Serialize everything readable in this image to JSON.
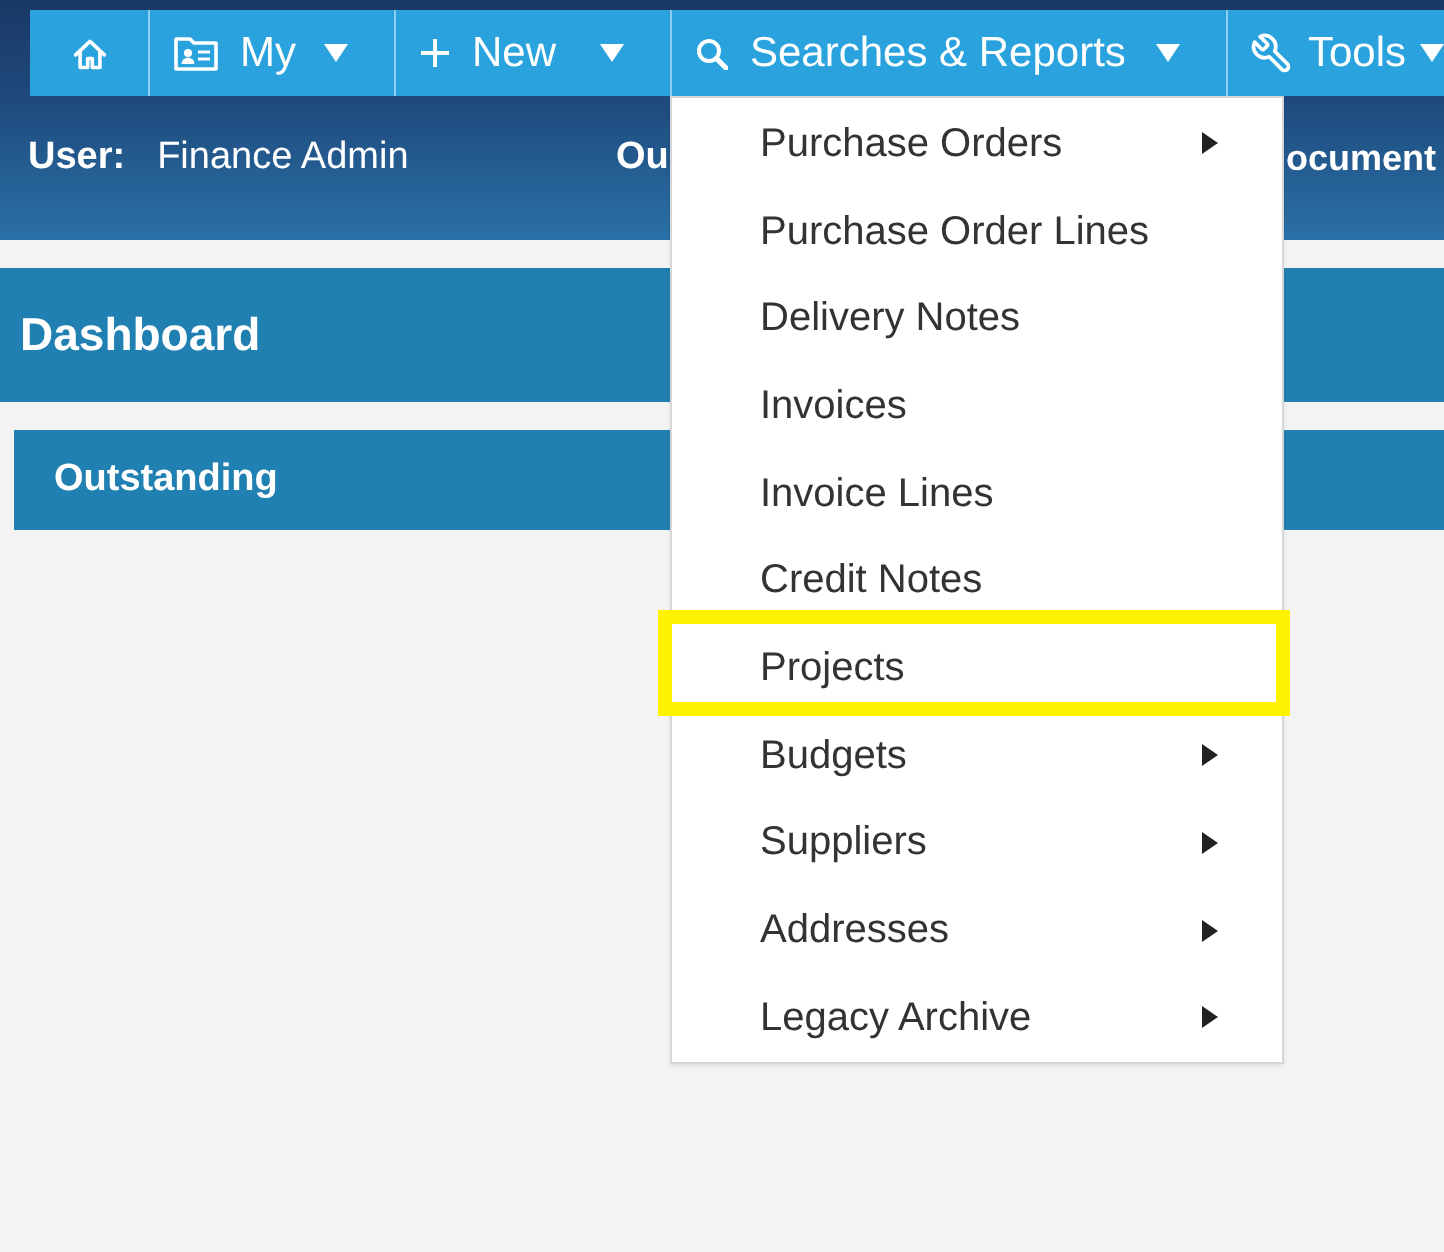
{
  "header": {
    "nav": [
      {
        "dropdown": false,
        "expanded": false
      },
      {
        "label": "My",
        "dropdown": true,
        "expanded": false
      },
      {
        "label": "New",
        "dropdown": true,
        "expanded": false
      },
      {
        "label": "Searches & Reports",
        "dropdown": true,
        "expanded": true,
        "menu": [
          {
            "label": "Purchase Orders",
            "submenu": true,
            "highlighted": false
          },
          {
            "label": "Purchase Order Lines",
            "submenu": false,
            "highlighted": false
          },
          {
            "label": "Delivery Notes",
            "submenu": false,
            "highlighted": false
          },
          {
            "label": "Invoices",
            "submenu": false,
            "highlighted": false
          },
          {
            "label": "Invoice Lines",
            "submenu": false,
            "highlighted": false
          },
          {
            "label": "Credit Notes",
            "submenu": false,
            "highlighted": false
          },
          {
            "label": "Projects",
            "submenu": false,
            "highlighted": true
          },
          {
            "label": "Budgets",
            "submenu": true,
            "highlighted": false
          },
          {
            "label": "Suppliers",
            "submenu": true,
            "highlighted": false
          },
          {
            "label": "Addresses",
            "submenu": true,
            "highlighted": false
          },
          {
            "label": "Legacy Archive",
            "submenu": true,
            "highlighted": false
          }
        ]
      },
      {
        "label": "Tools",
        "dropdown": true,
        "expanded": false
      }
    ],
    "user_label": "User:",
    "user_name": "Finance Admin",
    "label_2": "Ou",
    "label_3": "ocument"
  },
  "dashboard": {
    "title": "Dashboard",
    "panels": [
      {
        "title": "Outstanding"
      }
    ]
  }
}
